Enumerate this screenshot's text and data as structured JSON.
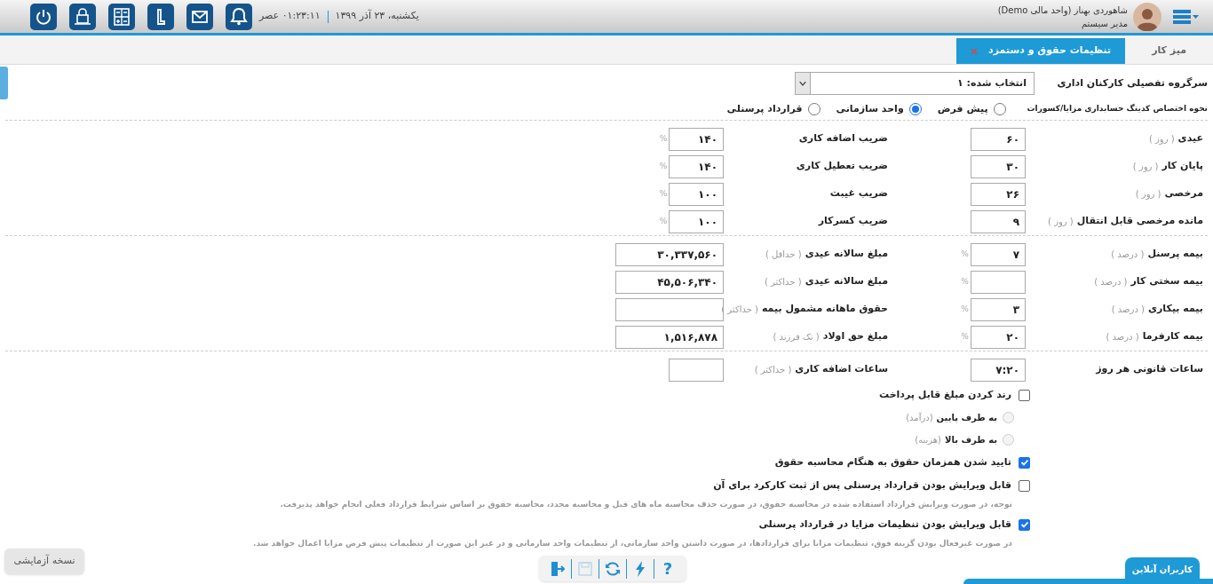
{
  "header": {
    "user_name": "شاهوردی بهناز (واحد مالی Demo)",
    "user_role": "مدیر سیستم",
    "date": "یکشنبه، ۲۳ آذر ۱۳۹۹",
    "time": "۰۱:۲۳:۱۱ عصر"
  },
  "tabs": [
    {
      "label": "میز کار",
      "selected": false,
      "closable": false
    },
    {
      "label": "تنظیمات حقوق و دستمزد",
      "selected": true,
      "closable": true
    }
  ],
  "group_select": {
    "label": "سرگروه تفصیلی کارکنان اداری",
    "value": "انتخاب شده: ۱"
  },
  "coding": {
    "label": "نحوه اختصاص کدینگ حسابداری مزایا/کسورات",
    "options": [
      {
        "label": "پیش فرض",
        "selected": false
      },
      {
        "label": "واحد سازمانی",
        "selected": true
      },
      {
        "label": "قرارداد پرسنلی",
        "selected": false
      }
    ]
  },
  "sections": [
    {
      "rows": [
        {
          "right": {
            "label": "عیدی",
            "hint": "( روز )",
            "value": "۶۰",
            "kind": "short"
          },
          "left": {
            "label": "ضریب اضافه کاری",
            "value": "۱۴۰",
            "unit": "%",
            "kind": "short"
          }
        },
        {
          "right": {
            "label": "پایان کار",
            "hint": "( روز )",
            "value": "۳۰",
            "kind": "short"
          },
          "left": {
            "label": "ضریب تعطیل کاری",
            "value": "۱۴۰",
            "unit": "%",
            "kind": "short"
          }
        },
        {
          "right": {
            "label": "مرخصی",
            "hint": "( روز )",
            "value": "۲۶",
            "kind": "short"
          },
          "left": {
            "label": "ضریب غیبت",
            "value": "۱۰۰",
            "unit": "%",
            "kind": "short"
          }
        },
        {
          "right": {
            "label": "مانده مرخصی قابل انتقال",
            "hint": "( روز )",
            "value": "۹",
            "kind": "short"
          },
          "left": {
            "label": "ضریب کسرکار",
            "value": "۱۰۰",
            "unit": "%",
            "kind": "short"
          }
        }
      ]
    },
    {
      "rows": [
        {
          "right": {
            "label": "بیمه پرسنل",
            "hint": "( درصد )",
            "value": "۷",
            "unit": "%",
            "kind": "short"
          },
          "left": {
            "label": "مبلغ سالانه عیدی",
            "hint": "( حداقل )",
            "value": "۳۰,۳۳۷,۵۶۰",
            "kind": "long"
          }
        },
        {
          "right": {
            "label": "بیمه سختی کار",
            "hint": "( درصد )",
            "unit": "%",
            "kind": "short"
          },
          "left": {
            "label": "مبلغ سالانه عیدی",
            "hint": "( حداکثر )",
            "value": "۴۵,۵۰۶,۳۴۰",
            "kind": "long"
          }
        },
        {
          "right": {
            "label": "بیمه بیکاری",
            "hint": "( درصد )",
            "value": "۳",
            "unit": "%",
            "kind": "short"
          },
          "left": {
            "label": "حقوق ماهانه مشمول بیمه",
            "hint": "( حداکثر )",
            "kind": "long"
          }
        },
        {
          "right": {
            "label": "بیمه کارفرما",
            "hint": "( درصد )",
            "value": "۲۰",
            "unit": "%",
            "kind": "short"
          },
          "left": {
            "label": "مبلغ حق اولاد",
            "hint": "( تک فرزند )",
            "value": "۱,۵۱۶,۸۷۸",
            "kind": "long"
          }
        }
      ]
    },
    {
      "rows": [
        {
          "right": {
            "label": "ساعات قانونی هر روز",
            "value": "۷:۲۰",
            "kind": "short"
          },
          "left": {
            "label": "ساعات اضافه کاری",
            "hint": "( حداکثر )",
            "kind": "short"
          }
        }
      ]
    }
  ],
  "options": [
    {
      "kind": "checkbox",
      "label": "رند کردن مبلغ قابل پرداخت",
      "checked": false
    },
    {
      "kind": "radio",
      "label": "به طرف پایین",
      "hint": "(درآمد)",
      "selected": false,
      "disabled": true
    },
    {
      "kind": "radio",
      "label": "به طرف بالا",
      "hint": "(هزینه)",
      "selected": false,
      "disabled": true
    },
    {
      "kind": "checkbox",
      "label": "تایید شدن همزمان حقوق به هنگام محاسبه حقوق",
      "checked": true
    },
    {
      "kind": "checkbox",
      "label": "قابل ویرایش بودن قرارداد پرسنلی پس از ثبت کارکرد برای آن",
      "checked": false
    },
    {
      "kind": "note",
      "label": "توجه، در صورت ویرایش قرارداد استفاده شده در محاسبه حقوق، در صورت حذف محاسبه ماه های قبل و محاسبه مجدد، محاسبه حقوق بر اساس شرایط قرارداد فعلی انجام خواهد پذیرفت."
    },
    {
      "kind": "checkbox",
      "label": "قابل ویرایش بودن تنظیمات مزایا در قرارداد پرسنلی",
      "checked": true
    },
    {
      "kind": "note",
      "label": "در صورت غیرفعال بودن گزینه فوق، تنظیمات مزایا برای قراردادها، در صورت داشتن واحد سازمانی، از تنظیمات واحد سازمانی و در غیر این صورت از تنظیمات پیش فرض مزایا اعمال خواهد شد."
    }
  ],
  "toolbar": [
    {
      "kind": "exit",
      "disabled": false
    },
    {
      "kind": "save",
      "disabled": true
    },
    {
      "kind": "refresh",
      "disabled": false
    },
    {
      "kind": "flash",
      "disabled": false
    },
    {
      "kind": "help",
      "label": "?",
      "disabled": false
    }
  ],
  "version_badge": "نسخه آزمایشی",
  "online_users_tab": "کاربران آنلاین"
}
